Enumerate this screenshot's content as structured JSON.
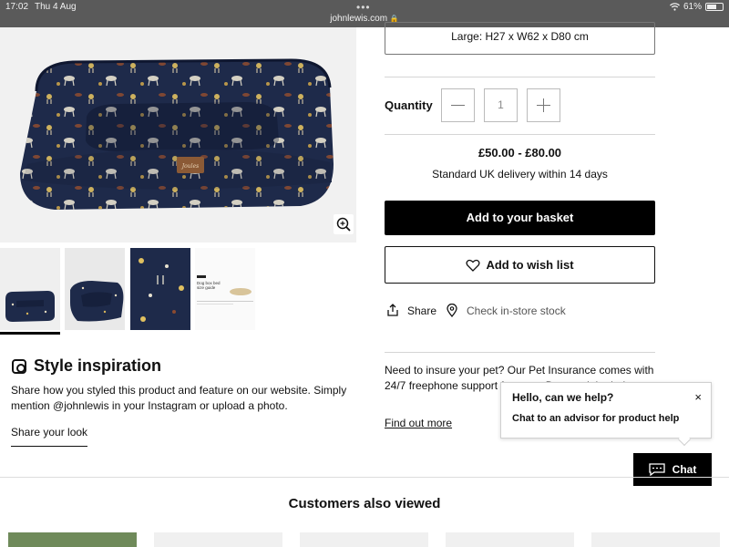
{
  "status_bar": {
    "time": "17:02",
    "date": "Thu 4 Aug",
    "url": "johnlewis.com",
    "battery": "61%",
    "battery_level": 0.61
  },
  "product": {
    "size_option": "Large: H27 x W62 x D80 cm",
    "quantity_label": "Quantity",
    "quantity_value": "1",
    "price": "£50.00 - £80.00",
    "delivery": "Standard UK delivery within 14 days",
    "add_to_basket": "Add to your basket",
    "add_to_wish_list": "Add to wish list",
    "share": "Share",
    "check_stock": "Check in-store stock",
    "label_text": "Joules"
  },
  "thumbnail_caption": {
    "line1": "Dog box bed",
    "line2": "size guide"
  },
  "style_inspiration": {
    "title": "Style inspiration",
    "text": "Share how you styled this product and feature on our website. Simply mention @johnlewis in your Instagram or upload a photo.",
    "link": "Share your look"
  },
  "insurance": {
    "text": "Need to insure your pet? Our Pet Insurance comes with 24/7 freephone support f nurses. Day or night, help",
    "link": "Find out more"
  },
  "chat": {
    "popup_title": "Hello, can we help?",
    "popup_close": "×",
    "popup_sub": "Chat to an advisor for product help",
    "button": "Chat"
  },
  "customers_also_viewed": {
    "title": "Customers also viewed"
  },
  "colors": {
    "bed_navy": "#1e2a4a",
    "accent_black": "#000000",
    "status_bar": "#5a5a5a"
  }
}
